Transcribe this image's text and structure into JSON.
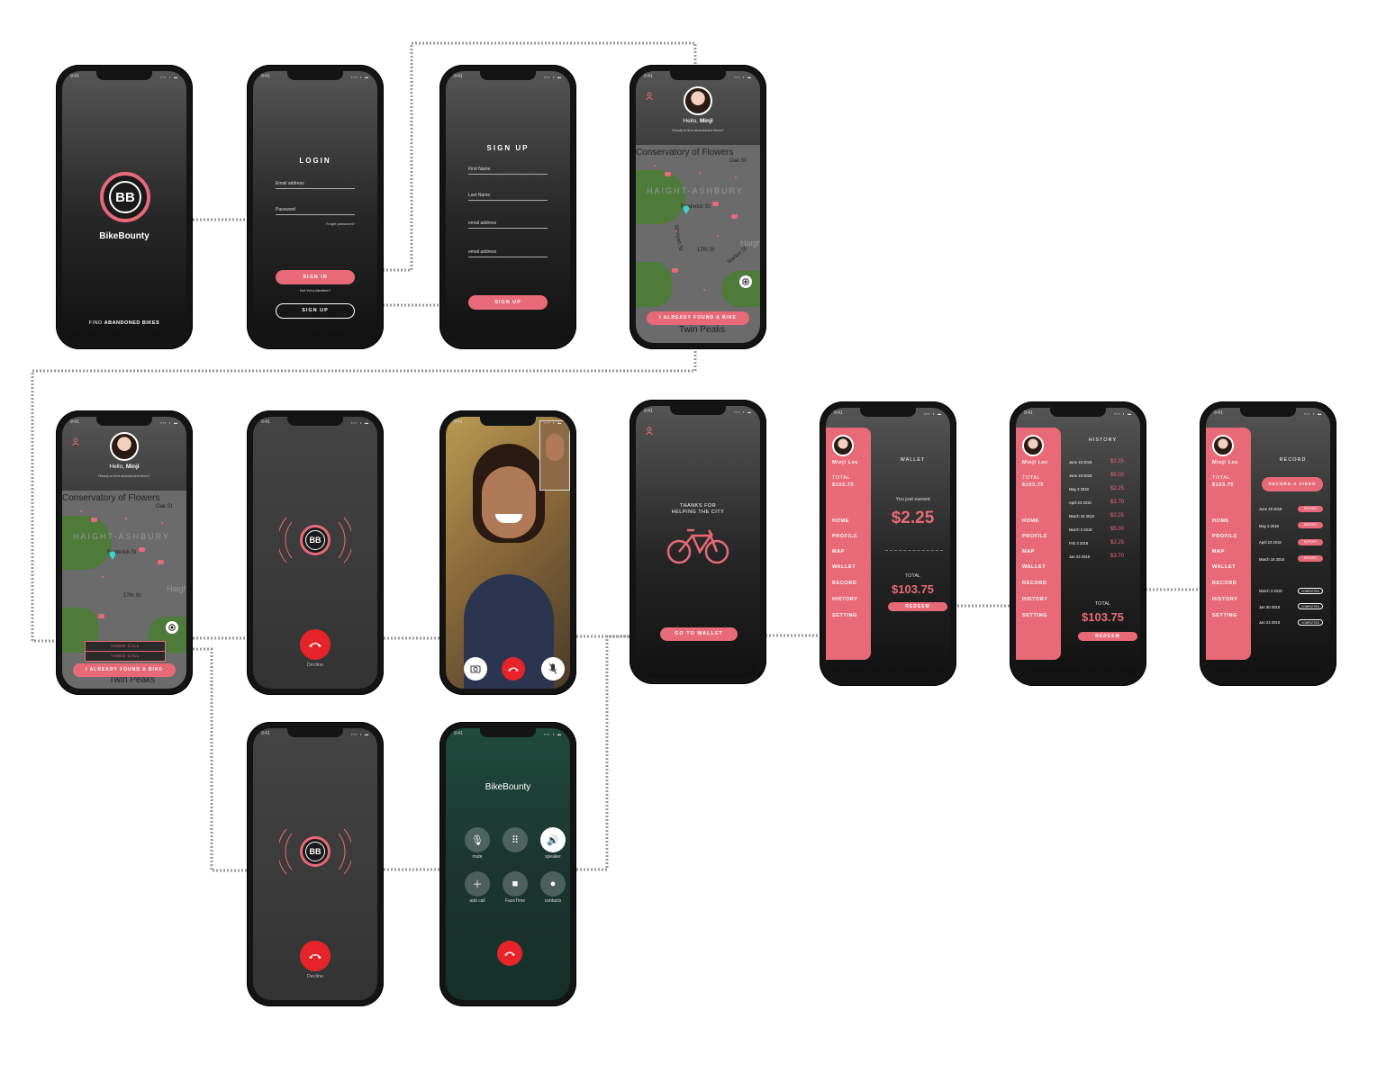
{
  "status_time": "9:41",
  "status_icons": "▪▪▪ ◗ ▬",
  "colors": {
    "accent": "#e86a78",
    "decline_red": "#e8242b",
    "phone_frame": "#141414"
  },
  "icons": {
    "user": "user-icon",
    "bike": "bicycle-icon",
    "location": "location-target-icon",
    "phone_hang": "hang-up-icon"
  },
  "splash": {
    "logo": "BB",
    "brand": "BikeBounty",
    "tagline_pre": "FIND ",
    "tagline_bold": "ABANDONED BIKES"
  },
  "login": {
    "title": "LOGIN",
    "email_label": "Email address",
    "password_label": "Password",
    "forgot": "Forget password?",
    "sign_in": "SIGN IN",
    "not_member": "Not Yet a Member?",
    "sign_up": "SIGN UP"
  },
  "signup": {
    "title": "SIGN UP",
    "fields": [
      "First Name",
      "Last Name",
      "email address",
      "email address"
    ],
    "button": "SIGN UP"
  },
  "home": {
    "hello": "Hello, ",
    "name": "Minji",
    "subtitle": "Ready to find abandoned bikes?",
    "map_labels": {
      "conservatory": "Conservatory of Flowers",
      "district": "HAIGHT-ASHBURY",
      "street1": "Oak St",
      "street2": "Frederick St",
      "street3": "17th St",
      "street4": "Stanyan St",
      "street5": "Clarendon Ave",
      "street6": "Market St",
      "peaks": "Twin Peaks",
      "haight": "Haigh"
    },
    "found_button": "I ALREADY FOUND A BIKE",
    "audio_call": "AUDIO CALL",
    "video_call": "VIDEO CALL"
  },
  "calling": {
    "logo": "BB",
    "decline": "Decline"
  },
  "facetime": {},
  "thanks": {
    "line1": "THANKS FOR",
    "line2": "HELPING THE CITY",
    "go_wallet": "GO TO WALLET"
  },
  "sidebar": {
    "name": "Minji Lee",
    "total_label": "TOTAL",
    "total_value": "$103.75",
    "menu": [
      "HOME",
      "PROFILE",
      "MAP",
      "WALLET",
      "RECORD",
      "HISTORY",
      "SETTING"
    ]
  },
  "wallet": {
    "title": "WALLET",
    "earned_label": "You just earned",
    "earned_value": "$2.25",
    "total_label": "TOTAL",
    "total_value": "$103.75",
    "redeem": "REDEEM"
  },
  "history": {
    "title": "HISTORY",
    "rows": [
      {
        "date": "June 16 2018",
        "amount": "$2.25"
      },
      {
        "date": "June 19 2018",
        "amount": "$5.00"
      },
      {
        "date": "May 3 2018",
        "amount": "$2.25"
      },
      {
        "date": "April 23 2018",
        "amount": "$3.70"
      },
      {
        "date": "March 16 2018",
        "amount": "$2.25"
      },
      {
        "date": "March 3 2018",
        "amount": "$5.00"
      },
      {
        "date": "Feb 3 2018",
        "amount": "$2.25"
      },
      {
        "date": "Jan 23 2018",
        "amount": "$3.70"
      }
    ],
    "total_label": "TOTAL",
    "total_value": "$103.75",
    "redeem": "REDEEM"
  },
  "record": {
    "title": "RECORD",
    "record_button": "RECORD A VIDEO",
    "report_label": "REPORT",
    "completed_label": "COMPLETED",
    "pending": [
      "June 19 2018",
      "May 3 2018",
      "April 23 2018",
      "March 16 2018"
    ],
    "completed": [
      "March 3 2018",
      "Jan 30 2018",
      "Jan 23 2018"
    ]
  },
  "ios_call": {
    "caller": "BikeBounty",
    "buttons": [
      "mute",
      "keypad",
      "speaker",
      "add call",
      "FaceTime",
      "contacts"
    ],
    "labels": [
      "mute",
      "",
      "speaker",
      "add call",
      "FaceTime",
      "contacts"
    ]
  }
}
